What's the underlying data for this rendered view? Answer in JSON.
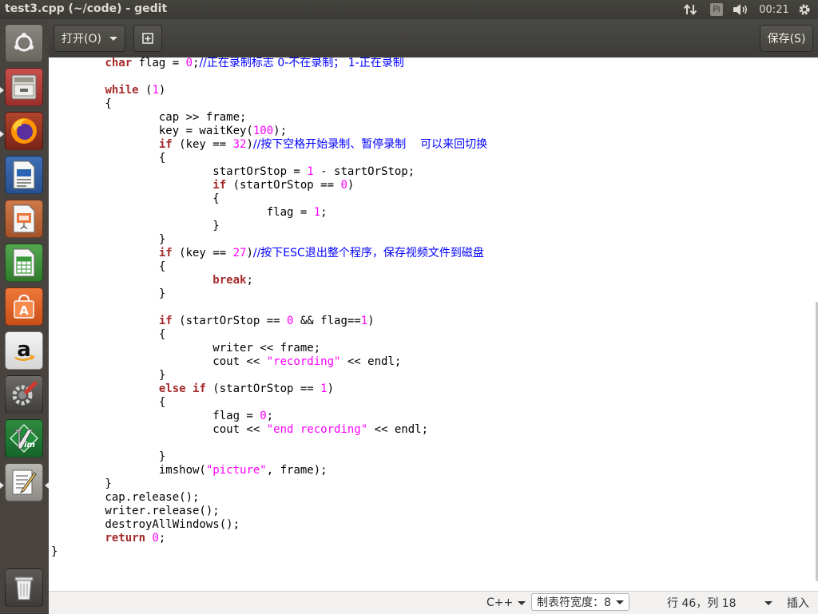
{
  "window": {
    "title": "test3.cpp (~/code) - gedit"
  },
  "topbar": {
    "keyboard_indicator": "Pi",
    "clock": "00:21"
  },
  "launcher": {
    "items": [
      {
        "name": "ubuntu-dash"
      },
      {
        "name": "files"
      },
      {
        "name": "firefox"
      },
      {
        "name": "libreoffice-writer"
      },
      {
        "name": "libreoffice-impress"
      },
      {
        "name": "libreoffice-calc"
      },
      {
        "name": "ubuntu-software"
      },
      {
        "name": "amazon"
      },
      {
        "name": "system-settings"
      },
      {
        "name": "vim"
      },
      {
        "name": "text-editor"
      },
      {
        "name": "trash"
      }
    ]
  },
  "headerbar": {
    "open_label": "打开(O)",
    "save_label": "保存(S)"
  },
  "code_lines": [
    [
      [
        "        ",
        ""
      ],
      [
        "char",
        "kw"
      ],
      [
        " flag = ",
        ""
      ],
      [
        "0",
        "nu"
      ],
      [
        ";",
        ""
      ],
      [
        "//正在录制标志 0-不在录制； 1-正在录制",
        "cm"
      ]
    ],
    [
      [
        "",
        ""
      ]
    ],
    [
      [
        "        ",
        ""
      ],
      [
        "while",
        "kw"
      ],
      [
        " (",
        ""
      ],
      [
        "1",
        "nu"
      ],
      [
        ")",
        ""
      ]
    ],
    [
      [
        "        {",
        ""
      ]
    ],
    [
      [
        "                cap >> frame;",
        ""
      ]
    ],
    [
      [
        "                key = waitKey(",
        ""
      ],
      [
        "100",
        "nu"
      ],
      [
        ");",
        ""
      ]
    ],
    [
      [
        "                ",
        ""
      ],
      [
        "if",
        "kw"
      ],
      [
        " (key == ",
        ""
      ],
      [
        "32",
        "nu"
      ],
      [
        ")",
        ""
      ],
      [
        "//按下空格开始录制、暂停录制    可以来回切换",
        "cm"
      ]
    ],
    [
      [
        "                {",
        ""
      ]
    ],
    [
      [
        "                        startOrStop = ",
        ""
      ],
      [
        "1",
        "nu"
      ],
      [
        " - startOrStop;",
        ""
      ]
    ],
    [
      [
        "                        ",
        ""
      ],
      [
        "if",
        "kw"
      ],
      [
        " (startOrStop == ",
        ""
      ],
      [
        "0",
        "nu"
      ],
      [
        ")",
        ""
      ]
    ],
    [
      [
        "                        {",
        ""
      ]
    ],
    [
      [
        "                                flag = ",
        ""
      ],
      [
        "1",
        "nu"
      ],
      [
        ";",
        ""
      ]
    ],
    [
      [
        "                        }",
        ""
      ]
    ],
    [
      [
        "                }",
        ""
      ]
    ],
    [
      [
        "                ",
        ""
      ],
      [
        "if",
        "kw"
      ],
      [
        " (key == ",
        ""
      ],
      [
        "27",
        "nu"
      ],
      [
        ")",
        ""
      ],
      [
        "//按下ESC退出整个程序，保存视频文件到磁盘",
        "cm"
      ]
    ],
    [
      [
        "                {",
        ""
      ]
    ],
    [
      [
        "                        ",
        ""
      ],
      [
        "break",
        "kw"
      ],
      [
        ";",
        ""
      ]
    ],
    [
      [
        "                }",
        ""
      ]
    ],
    [
      [
        "",
        ""
      ]
    ],
    [
      [
        "                ",
        ""
      ],
      [
        "if",
        "kw"
      ],
      [
        " (startOrStop == ",
        ""
      ],
      [
        "0",
        "nu"
      ],
      [
        " && flag==",
        ""
      ],
      [
        "1",
        "nu"
      ],
      [
        ")",
        ""
      ]
    ],
    [
      [
        "                {",
        ""
      ]
    ],
    [
      [
        "                        writer << frame;",
        ""
      ]
    ],
    [
      [
        "                        cout << ",
        ""
      ],
      [
        "\"recording\"",
        "st"
      ],
      [
        " << endl;",
        ""
      ]
    ],
    [
      [
        "                }",
        ""
      ]
    ],
    [
      [
        "                ",
        ""
      ],
      [
        "else",
        "kw"
      ],
      [
        " ",
        ""
      ],
      [
        "if",
        "kw"
      ],
      [
        " (startOrStop == ",
        ""
      ],
      [
        "1",
        "nu"
      ],
      [
        ")",
        ""
      ]
    ],
    [
      [
        "                {",
        ""
      ]
    ],
    [
      [
        "                        flag = ",
        ""
      ],
      [
        "0",
        "nu"
      ],
      [
        ";",
        ""
      ]
    ],
    [
      [
        "                        cout << ",
        ""
      ],
      [
        "\"end recording\"",
        "st"
      ],
      [
        " << endl;",
        ""
      ]
    ],
    [
      [
        "",
        ""
      ]
    ],
    [
      [
        "                }",
        ""
      ]
    ],
    [
      [
        "                imshow(",
        ""
      ],
      [
        "\"picture\"",
        "st"
      ],
      [
        ", frame);",
        ""
      ]
    ],
    [
      [
        "        }",
        ""
      ]
    ],
    [
      [
        "        cap.release();",
        ""
      ]
    ],
    [
      [
        "        writer.release();",
        ""
      ]
    ],
    [
      [
        "        destroyAllWindows();",
        ""
      ]
    ],
    [
      [
        "        ",
        ""
      ],
      [
        "return",
        "kw"
      ],
      [
        " ",
        ""
      ],
      [
        "0",
        "nu"
      ],
      [
        ";",
        ""
      ]
    ],
    [
      [
        "}",
        ""
      ]
    ]
  ],
  "statusbar": {
    "language": "C++",
    "tab_width": "制表符宽度：8",
    "position": "行 46，列 18",
    "insert_mode": "插入"
  }
}
